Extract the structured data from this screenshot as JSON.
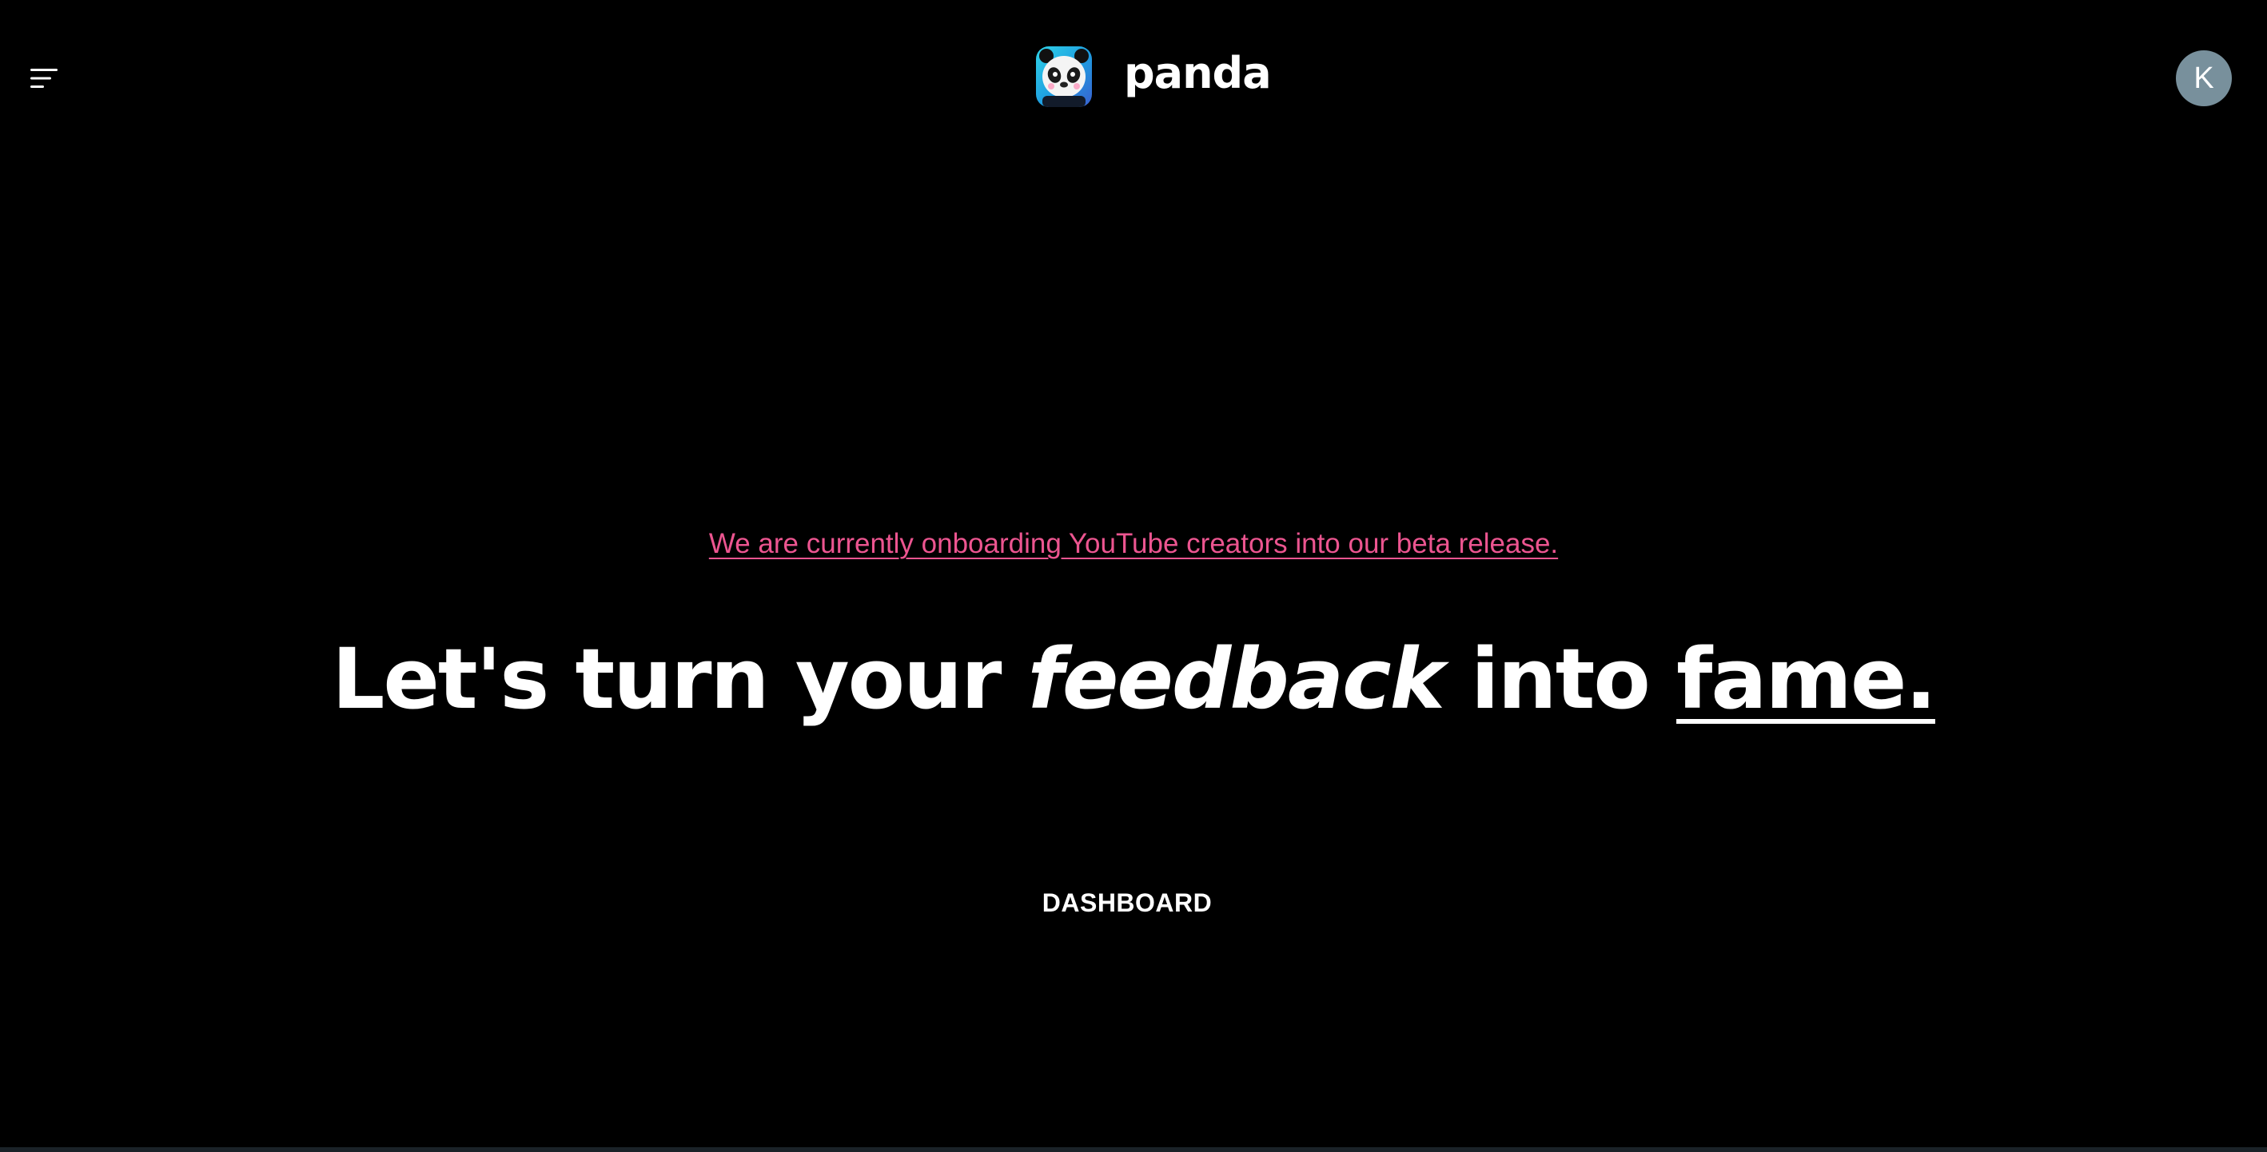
{
  "header": {
    "menu_icon": "hamburger-menu-icon",
    "brand_name": "panda",
    "logo_icon": "panda-logo-icon",
    "avatar_initial": "K",
    "avatar_color": "#78909c"
  },
  "hero": {
    "beta_notice": "We are currently onboarding YouTube creators into our beta release.",
    "beta_notice_color": "#ec5590",
    "headline_part1": "Let's turn your ",
    "headline_emphasis": "feedback",
    "headline_part2": " into ",
    "headline_underlined": "fame.",
    "cta_label": "DASHBOARD"
  },
  "colors": {
    "background": "#000000",
    "text": "#ffffff"
  }
}
